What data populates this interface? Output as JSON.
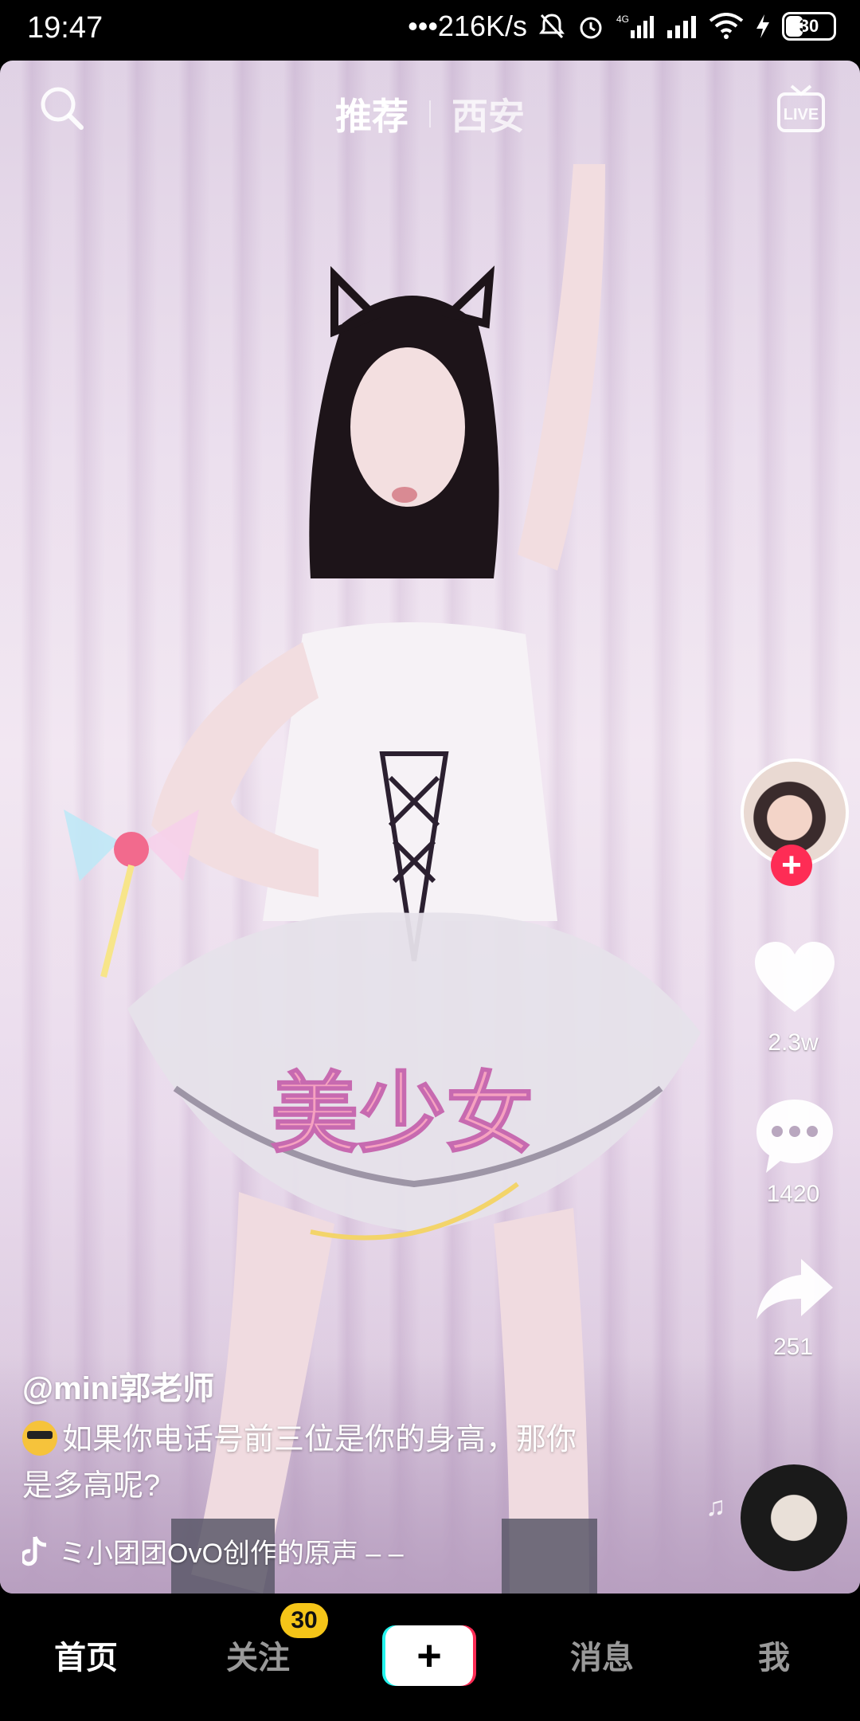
{
  "status_bar": {
    "time": "19:47",
    "network_speed": "•••216K/s",
    "icons": [
      "bell-muted-icon",
      "alarm-icon",
      "signal-4g-icon",
      "signal-icon",
      "wifi-icon",
      "charging-icon"
    ],
    "battery": "30"
  },
  "top_nav": {
    "tab_recommend": "推荐",
    "tab_city": "西安",
    "search_icon": "search-icon",
    "live_icon": "live-tv-icon",
    "live_label": "LIVE"
  },
  "video": {
    "watermark_text": "美少女"
  },
  "rail": {
    "likes": "2.3w",
    "comments": "1420",
    "shares": "251",
    "follow_symbol": "+"
  },
  "post": {
    "author": "@mini郭老师",
    "caption_line1": "如果你电话号前三位是你的身高，那你",
    "caption_line2": "是多高呢?",
    "sound": "ミ小团团OvO创作的原声 – –",
    "music_notes": "♫"
  },
  "bottom_nav": {
    "home": "首页",
    "follow": "关注",
    "follow_badge": "30",
    "plus": "+",
    "messages": "消息",
    "me": "我"
  },
  "colors": {
    "accent_red": "#fe2c55",
    "accent_cyan": "#25f4ee",
    "badge_yellow": "#f5c518"
  }
}
